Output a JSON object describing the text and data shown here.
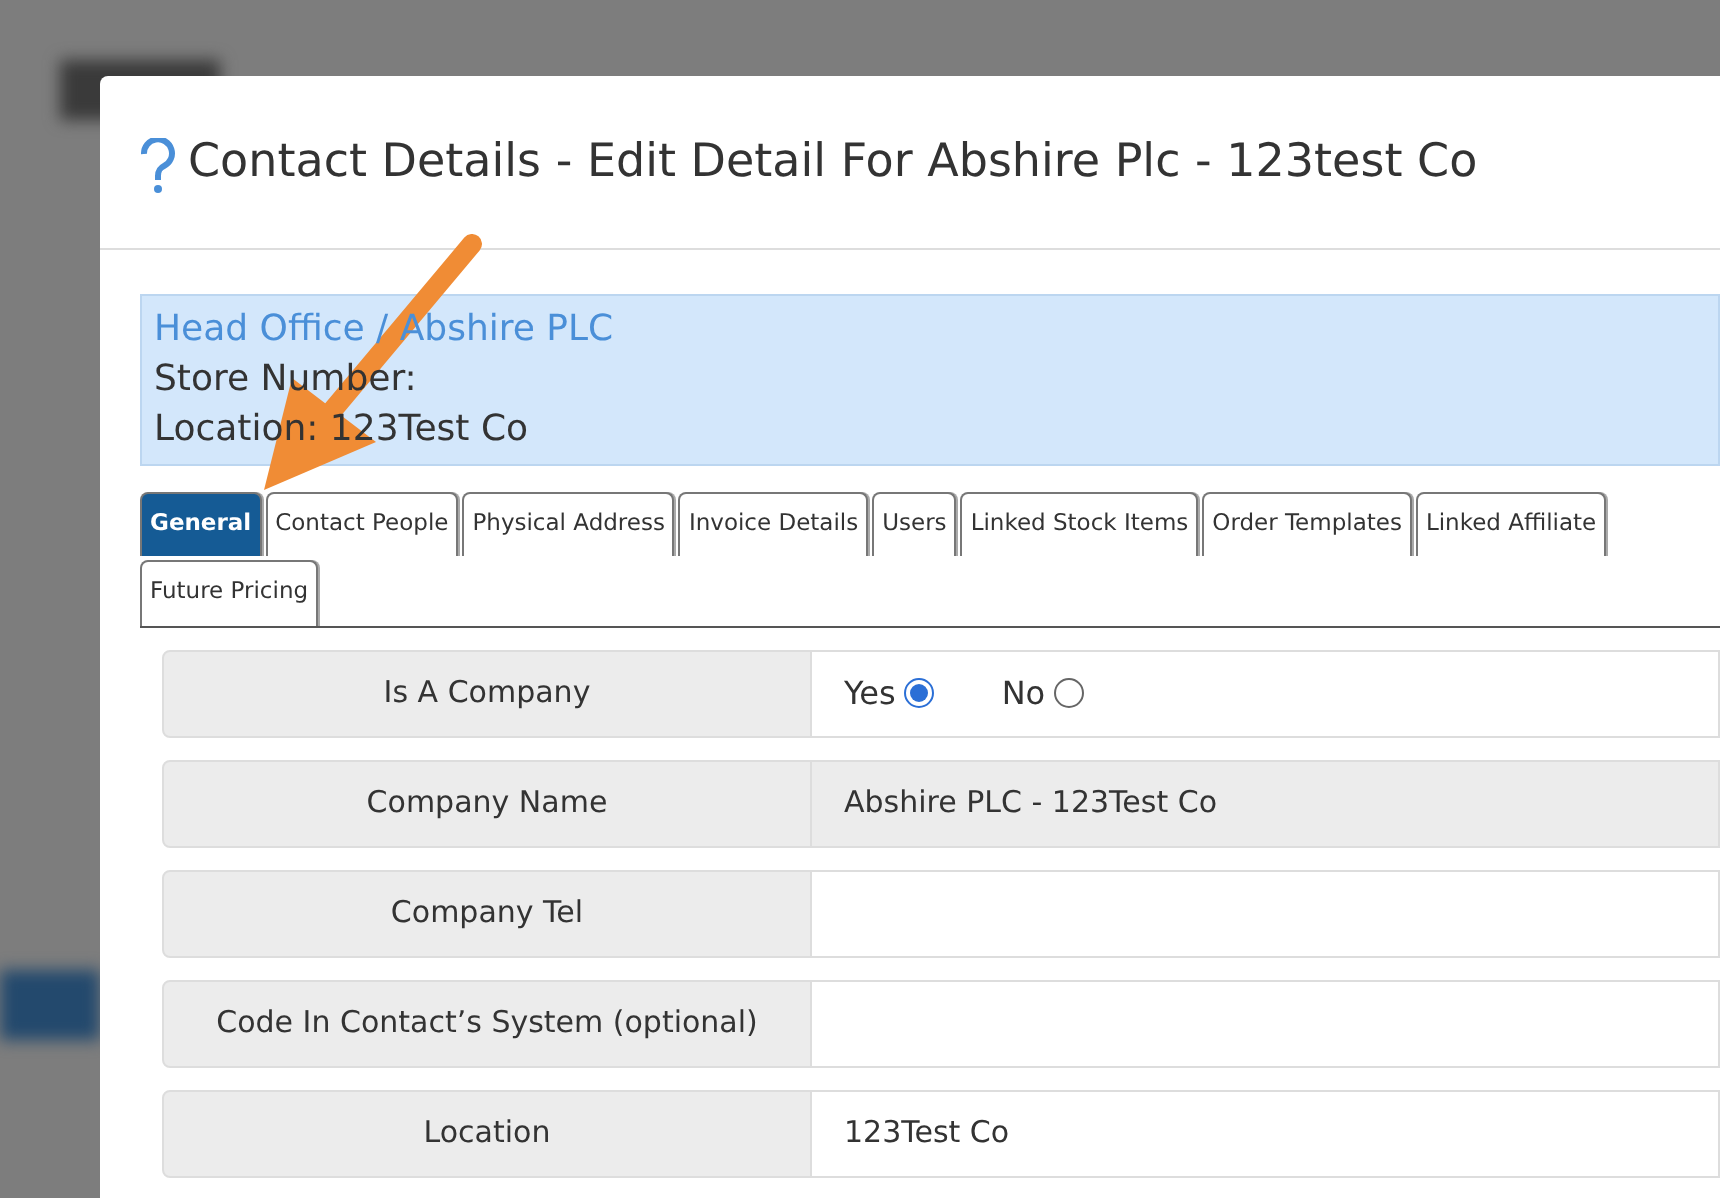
{
  "dialog": {
    "title": "Contact Details - Edit Detail For Abshire Plc - 123test Co"
  },
  "info": {
    "heading": "Head Office / Abshire PLC",
    "lines": [
      "Store Number:",
      "Location: 123Test Co"
    ]
  },
  "tabs": [
    {
      "label": "General",
      "selected": true
    },
    {
      "label": "Contact People",
      "selected": false
    },
    {
      "label": "Physical Address",
      "selected": false
    },
    {
      "label": "Invoice Details",
      "selected": false
    },
    {
      "label": "Users",
      "selected": false
    },
    {
      "label": "Linked Stock Items",
      "selected": false
    },
    {
      "label": "Order Templates",
      "selected": false
    },
    {
      "label": "Linked Affiliate",
      "selected": false
    },
    {
      "label": "Future Pricing",
      "selected": false
    }
  ],
  "fields": [
    {
      "kind": "radio",
      "label": "Is A Company",
      "options": [
        {
          "label": "Yes",
          "selected": true
        },
        {
          "label": "No",
          "selected": false
        }
      ]
    },
    {
      "kind": "text",
      "label": "Company Name",
      "value": "Abshire PLC - 123Test Co",
      "readonly": true
    },
    {
      "kind": "text",
      "label": "Company Tel",
      "readonly": false
    },
    {
      "kind": "text",
      "label": "Code In Contact’s System (optional)",
      "readonly": false
    },
    {
      "kind": "text",
      "label": "Location",
      "value": "123Test Co",
      "readonly": false
    }
  ]
}
